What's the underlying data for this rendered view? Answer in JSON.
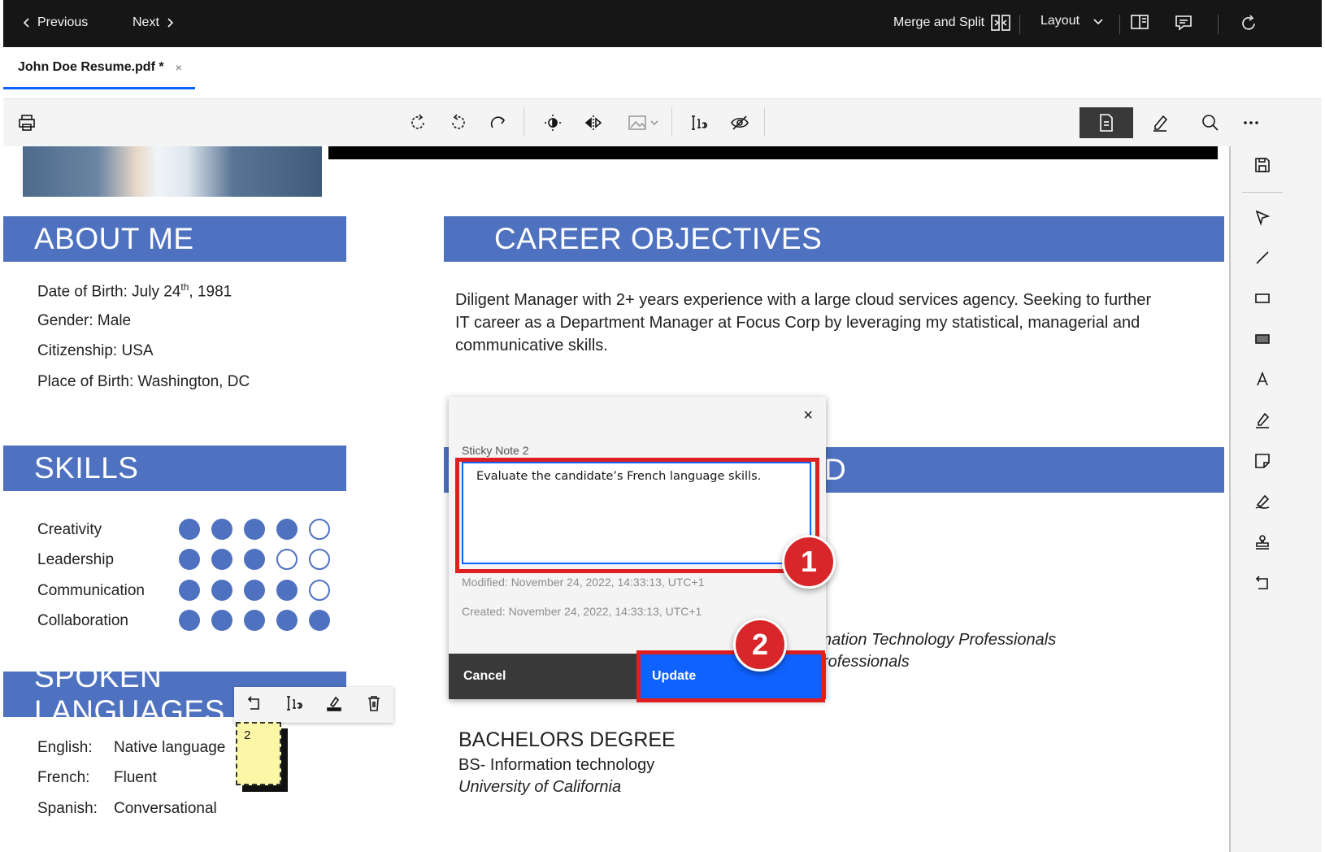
{
  "topbar": {
    "previous_label": "Previous",
    "next_label": "Next",
    "merge_split_label": "Merge and Split",
    "layout_label": "Layout"
  },
  "tab": {
    "title": "John Doe Resume.pdf *",
    "close": "×"
  },
  "document": {
    "about_me_heading": "ABOUT ME",
    "about": {
      "dob_prefix": "Date of Birth: July 24",
      "dob_sup": "th",
      "dob_suffix": ", 1981",
      "gender": "Gender: Male",
      "citizenship": "Citizenship: USA",
      "place_of_birth": "Place of Birth: Washington, DC"
    },
    "career_heading": "CAREER OBJECTIVES",
    "career_text": "Diligent Manager with 2+ years experience with a large cloud services agency. Seeking to further IT career as a Department Manager at Focus Corp  by leveraging my statistical, managerial and communicative skills.",
    "hidden_heading_tail": "D",
    "skills_heading": "SKILLS",
    "skills": [
      {
        "name": "Creativity",
        "level": 4,
        "max": 5
      },
      {
        "name": "Leadership",
        "level": 3,
        "max": 5
      },
      {
        "name": "Communication",
        "level": 4,
        "max": 5
      },
      {
        "name": "Collaboration",
        "level": 5,
        "max": 5
      }
    ],
    "languages_heading": "SPOKEN LANGUAGES",
    "languages": [
      {
        "lang": "English:",
        "level": "Native language"
      },
      {
        "lang": "French:",
        "level": "Fluent"
      },
      {
        "lang": "Spanish:",
        "level": "Conversational"
      }
    ],
    "cert_line1": "nation Technology Professionals",
    "cert_line2": "rofessionals",
    "degree_heading": "BACHELORS DEGREE",
    "degree_field": "BS- Information technology",
    "degree_school": "University of California"
  },
  "dialog": {
    "close": "×",
    "note_label": "Sticky Note 2",
    "note_text": "Evaluate the candidate’s French language skills.",
    "modified": "Modified: November 24, 2022, 14:33:13, UTC+1",
    "created": "Created: November 24, 2022, 14:33:13, UTC+1",
    "cancel_label": "Cancel",
    "update_label": "Update"
  },
  "callouts": {
    "one": "1",
    "two": "2"
  },
  "sticky_marker": {
    "number": "2"
  },
  "colors": {
    "accent": "#0f62fe",
    "section_blue": "#4f72c0",
    "callout_red": "#d8262a",
    "sticky_yellow": "#fbf7a6"
  }
}
